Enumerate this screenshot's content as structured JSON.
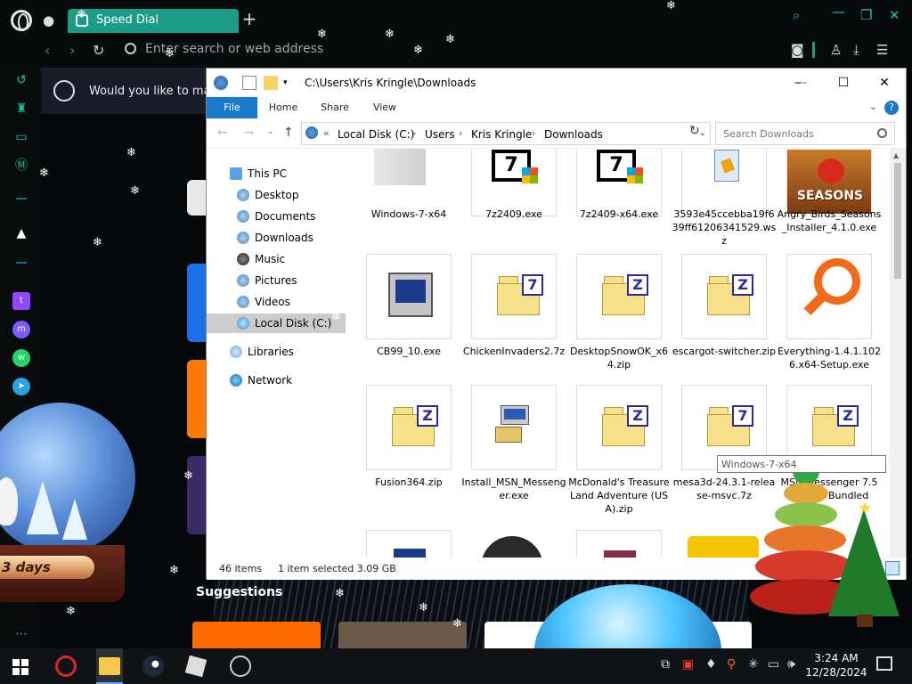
{
  "browser": {
    "tab_title": "Speed Dial",
    "address_placeholder": "Enter search or web address",
    "banner_text": "Would you like to make",
    "suggestions_label": "Suggestions",
    "accent_color": "#1b9c88"
  },
  "wallpaper": {
    "countdown_label": "3 days"
  },
  "explorer": {
    "title_path": "C:\\Users\\Kris Kringle\\Downloads",
    "ribbon_tabs": [
      "File",
      "Home",
      "Share",
      "View"
    ],
    "breadcrumb": [
      "«",
      "Local Disk (C:)",
      "Users",
      "Kris Kringle",
      "Downloads"
    ],
    "search_placeholder": "Search Downloads",
    "nav_items": [
      {
        "label": "This PC",
        "icon": "pc-icon"
      },
      {
        "label": "Desktop",
        "icon": "drive-icon"
      },
      {
        "label": "Documents",
        "icon": "drive-icon"
      },
      {
        "label": "Downloads",
        "icon": "drive-icon"
      },
      {
        "label": "Music",
        "icon": "music-icon"
      },
      {
        "label": "Pictures",
        "icon": "drive-icon"
      },
      {
        "label": "Videos",
        "icon": "drive-icon"
      },
      {
        "label": "Local Disk (C:)",
        "icon": "disk-icon"
      },
      {
        "label": "Libraries",
        "icon": "library-icon"
      },
      {
        "label": "Network",
        "icon": "network-icon"
      }
    ],
    "files": [
      {
        "name": "Windows-7-x64",
        "icon": "folder-icon"
      },
      {
        "name": "7z2409.exe",
        "icon": "7zip-icon"
      },
      {
        "name": "7z2409-x64.exe",
        "icon": "7zip-icon"
      },
      {
        "name": "3593e45ccebba19f639ff61206341529.wsz",
        "icon": "wsz-icon"
      },
      {
        "name": "Angry_Birds_Seasons_Installer_4.1.0.exe",
        "icon": "angry-birds-icon"
      },
      {
        "name": "CB99_10.exe",
        "icon": "exe-icon"
      },
      {
        "name": "ChickenInvaders2.7z",
        "icon": "7z-archive-icon"
      },
      {
        "name": "DesktopSnowOK_x64.zip",
        "icon": "zip-icon"
      },
      {
        "name": "escargot-switcher.zip",
        "icon": "zip-icon"
      },
      {
        "name": "Everything-1.4.1.1026.x64-Setup.exe",
        "icon": "everything-icon"
      },
      {
        "name": "Fusion364.zip",
        "icon": "zip-icon"
      },
      {
        "name": "Install_MSN_Messenger.exe",
        "icon": "installer-icon"
      },
      {
        "name": "McDonald's Treasure Land Adventure (USA).zip",
        "icon": "zip-icon"
      },
      {
        "name": "mesa3d-24.3.1-release-msvc.7z",
        "icon": "7z-archive-icon"
      },
      {
        "name": "MSN Messenger 7.5 English Bundled",
        "icon": "zip-icon"
      }
    ],
    "angry_birds_text": "SEASONS",
    "zip_letter": "Z",
    "sevenz_letter": "7",
    "tooltip": "Windows-7-x64",
    "status_count": "46 items",
    "status_selected": "1 item selected  3.09 GB"
  },
  "taskbar": {
    "time": "3:24 AM",
    "date": "12/28/2024"
  }
}
